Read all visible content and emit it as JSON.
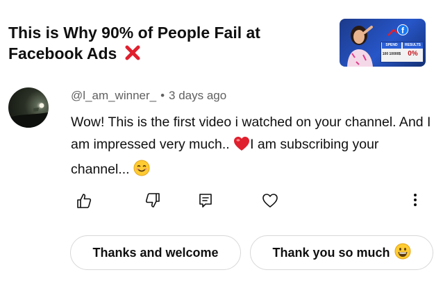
{
  "video": {
    "title_line1": "This is Why 90% of People Fail at",
    "title_line2": "Facebook Ads",
    "thumbnail": {
      "col1_label": "SPEND",
      "col2_label": "RESULTS",
      "col1_value": "100 10000$",
      "col2_value": "0%",
      "badge": "f"
    }
  },
  "comment": {
    "username": "@l_am_winner_",
    "separator": "•",
    "time": "3 days ago",
    "text_part1": "Wow! This is the first video i watched on your channel. And I am impressed very much.. ",
    "text_part2": "I am subscribing your channel... "
  },
  "actions": {
    "icons": [
      "thumbs-up-icon",
      "thumbs-down-icon",
      "reply-icon",
      "heart-icon",
      "more-vertical-icon"
    ]
  },
  "replies": {
    "chip1": "Thanks and welcome",
    "chip2": "Thank you so much"
  },
  "colors": {
    "text": "#0f0f0f",
    "meta": "#606060",
    "heart": "#e0202e",
    "x_mark": "#e0202e",
    "chip_border": "#d8d8d8"
  }
}
